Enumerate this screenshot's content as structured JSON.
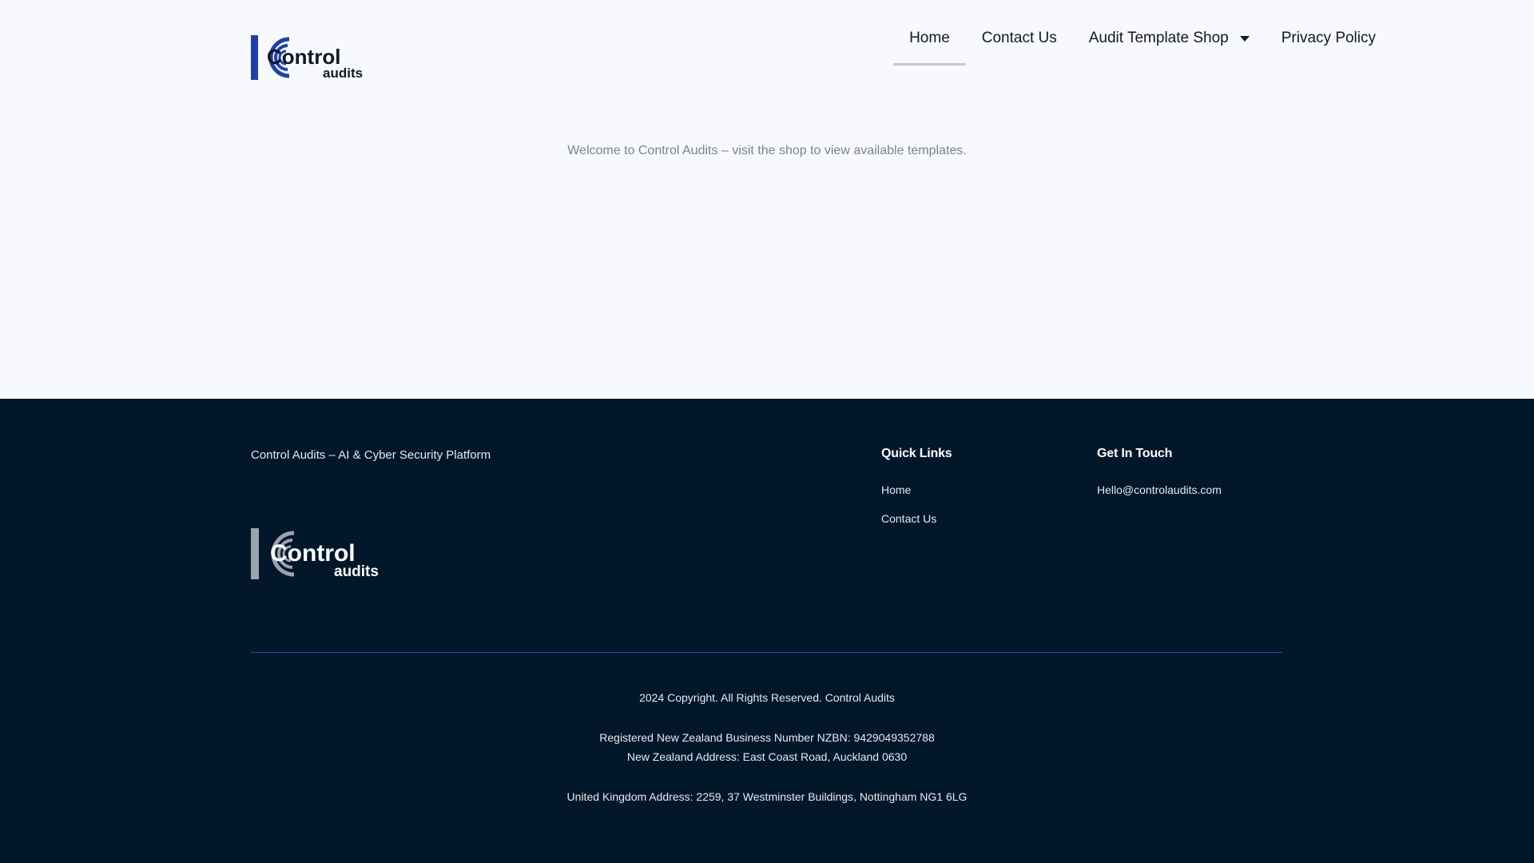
{
  "header": {
    "logo": {
      "word1": "Control",
      "word2": "audits",
      "accent_color": "#1e40af"
    },
    "nav": [
      {
        "label": "Home",
        "active": true
      },
      {
        "label": "Contact Us"
      },
      {
        "label": "Audit Template Shop",
        "has_dropdown": true
      },
      {
        "label": "Privacy Policy"
      }
    ]
  },
  "main": {
    "welcome_text": "Welcome to Control Audits – visit the shop to view available templates."
  },
  "footer": {
    "tagline": "Control Audits – AI & Cyber Security Platform",
    "logo": {
      "word1": "Control",
      "word2": "audits"
    },
    "quick_links": {
      "title": "Quick Links",
      "items": [
        "Home",
        "Contact Us"
      ]
    },
    "get_in_touch": {
      "title": "Get In Touch",
      "email": "Hello@controlaudits.com"
    },
    "copyright": "2024 Copyright. All Rights Reserved. Control Audits",
    "nzbn": "Registered New Zealand Business Number NZBN: 9429049352788",
    "nz_address": "New Zealand Address: East Coast Road, Auckland 0630",
    "uk_address": "United Kingdom Address: 2259, 37 Westminster Buildings, Nottingham NG1 6LG",
    "background_color": "#02172a"
  }
}
